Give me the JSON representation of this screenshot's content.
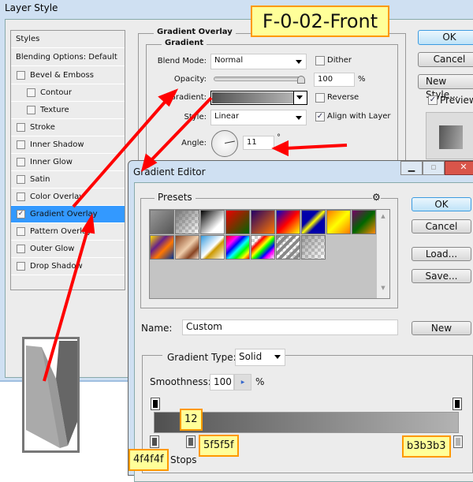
{
  "annotation_title": "F-0-02-Front",
  "layer_style": {
    "title": "Layer Style",
    "styles_header": "Styles",
    "blending": "Blending Options: Default",
    "items": [
      {
        "label": "Bevel & Emboss",
        "checked": false
      },
      {
        "label": "Contour",
        "checked": false
      },
      {
        "label": "Texture",
        "checked": false
      },
      {
        "label": "Stroke",
        "checked": false
      },
      {
        "label": "Inner Shadow",
        "checked": false
      },
      {
        "label": "Inner Glow",
        "checked": false
      },
      {
        "label": "Satin",
        "checked": false
      },
      {
        "label": "Color Overlay",
        "checked": false
      },
      {
        "label": "Gradient Overlay",
        "checked": true
      },
      {
        "label": "Pattern Overlay",
        "checked": false
      },
      {
        "label": "Outer Glow",
        "checked": false
      },
      {
        "label": "Drop Shadow",
        "checked": false
      }
    ],
    "panel_title": "Gradient Overlay",
    "group_title": "Gradient",
    "blend_mode_label": "Blend Mode:",
    "blend_mode": "Normal",
    "dither_label": "Dither",
    "dither": false,
    "opacity_label": "Opacity:",
    "opacity": "100",
    "opacity_unit": "%",
    "gradient_label": "Gradient:",
    "reverse_label": "Reverse",
    "reverse": false,
    "style_label": "Style:",
    "style": "Linear",
    "align_label": "Align with Layer",
    "align": true,
    "angle_label": "Angle:",
    "angle": "11",
    "angle_unit": "°",
    "ok": "OK",
    "cancel": "Cancel",
    "new_style": "New Style...",
    "preview_label": "Preview",
    "preview": true
  },
  "gradient_editor": {
    "title": "Gradient Editor",
    "presets_label": "Presets",
    "ok": "OK",
    "cancel": "Cancel",
    "load": "Load...",
    "save": "Save...",
    "name_label": "Name:",
    "name": "Custom",
    "new": "New",
    "type_label": "Gradient Type:",
    "type": "Solid",
    "smoothness_label": "Smoothness:",
    "smoothness": "100",
    "smoothness_unit": "%",
    "stops_label": "Stops",
    "stops": [
      {
        "color": "#4f4f4f",
        "location": 0
      },
      {
        "color": "#5f5f5f",
        "location": 12
      },
      {
        "color": "#b3b3b3",
        "location": 100
      }
    ]
  },
  "annotations": {
    "location": "12",
    "stop1": "4f4f4f",
    "stop2": "5f5f5f",
    "stop3": "b3b3b3"
  },
  "colors": {
    "selection": "#3399ff",
    "arrow": "#ff0000",
    "note_bg": "#ffff99",
    "note_border": "#ff9900"
  }
}
